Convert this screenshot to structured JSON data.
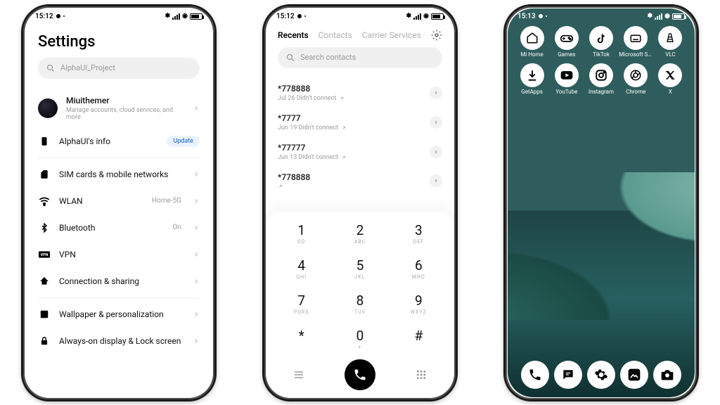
{
  "phone1": {
    "time": "15:12",
    "title": "Settings",
    "search_placeholder": "AlphaUI_Project",
    "account": {
      "name": "Miuithemer",
      "sub": "Manage accounts, cloud services, and more"
    },
    "info": {
      "label": "AlphaUI's info",
      "badge": "Update"
    },
    "items": [
      {
        "icon": "sim-icon",
        "label": "SIM cards & mobile networks",
        "value": ""
      },
      {
        "icon": "wifi-icon",
        "label": "WLAN",
        "value": "Home-5G"
      },
      {
        "icon": "bluetooth-icon",
        "label": "Bluetooth",
        "value": "On"
      },
      {
        "icon": "vpn-icon",
        "label": "VPN",
        "value": ""
      },
      {
        "icon": "share-icon",
        "label": "Connection & sharing",
        "value": ""
      }
    ],
    "items2": [
      {
        "icon": "wallpaper-icon",
        "label": "Wallpaper & personalization"
      },
      {
        "icon": "lock-icon",
        "label": "Always-on display & Lock screen"
      }
    ]
  },
  "phone2": {
    "time": "15:12",
    "tabs": [
      "Recents",
      "Contacts",
      "Carrier Services"
    ],
    "search_placeholder": "Search contacts",
    "calls": [
      {
        "number": "*778888",
        "meta": "Jul 26 Didn't connect"
      },
      {
        "number": "*7777",
        "meta": "Jun 19 Didn't connect"
      },
      {
        "number": "*77777",
        "meta": "Jun 13 Didn't connect"
      },
      {
        "number": "*778888",
        "meta": ""
      }
    ],
    "keys": [
      {
        "d": "1",
        "l": "GD"
      },
      {
        "d": "2",
        "l": "ABC"
      },
      {
        "d": "3",
        "l": "DEF"
      },
      {
        "d": "4",
        "l": "GHI"
      },
      {
        "d": "5",
        "l": "JKL"
      },
      {
        "d": "6",
        "l": "MNO"
      },
      {
        "d": "7",
        "l": "PQRS"
      },
      {
        "d": "8",
        "l": "TUV"
      },
      {
        "d": "9",
        "l": "WXYZ"
      },
      {
        "d": "*",
        "l": ""
      },
      {
        "d": "0",
        "l": "+"
      },
      {
        "d": "#",
        "l": ""
      }
    ]
  },
  "phone3": {
    "time": "15:13",
    "apps_row1": [
      {
        "name": "mi-home-icon",
        "label": "Mi Home"
      },
      {
        "name": "games-icon",
        "label": "Games"
      },
      {
        "name": "tiktok-icon",
        "label": "TikTok"
      },
      {
        "name": "swiftkey-icon",
        "label": "Microsoft SwiftKey ..."
      },
      {
        "name": "vlc-icon",
        "label": "VLC"
      }
    ],
    "apps_row2": [
      {
        "name": "getapps-icon",
        "label": "GetApps"
      },
      {
        "name": "youtube-icon",
        "label": "YouTube"
      },
      {
        "name": "instagram-icon",
        "label": "Instagram"
      },
      {
        "name": "chrome-icon",
        "label": "Chrome"
      },
      {
        "name": "x-icon",
        "label": "X"
      }
    ],
    "dock": [
      {
        "name": "phone-icon"
      },
      {
        "name": "messages-icon"
      },
      {
        "name": "settings-icon"
      },
      {
        "name": "gallery-icon"
      },
      {
        "name": "camera-icon"
      }
    ]
  }
}
